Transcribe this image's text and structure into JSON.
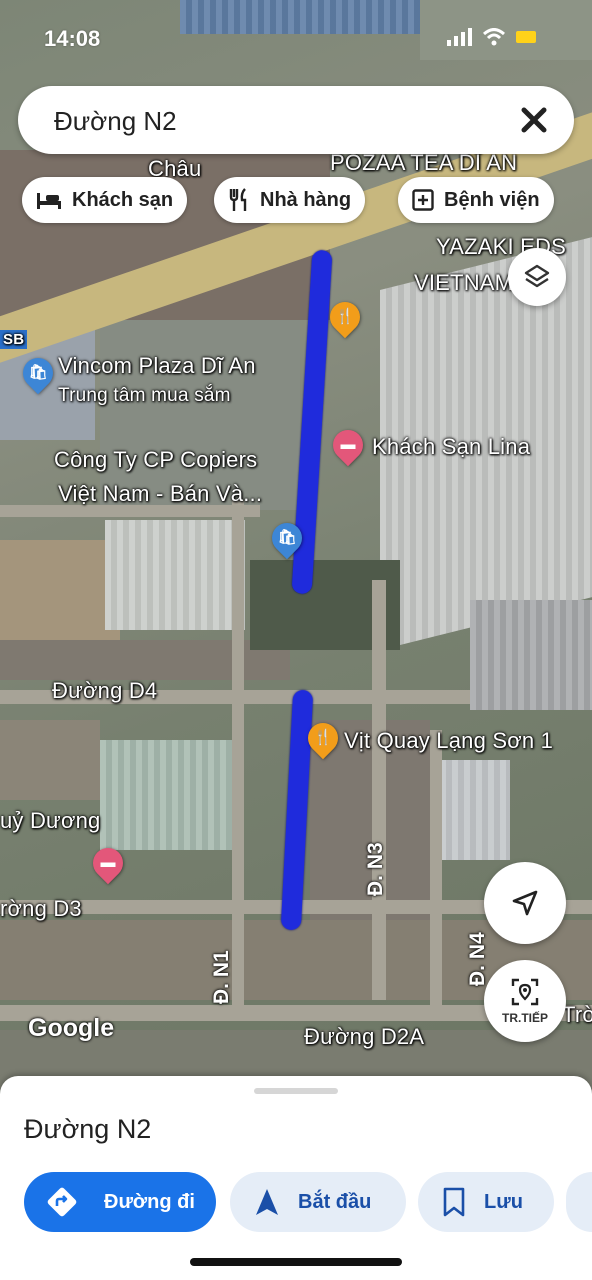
{
  "status_bar": {
    "time": "14:08"
  },
  "search": {
    "query": "Đường N2"
  },
  "chips": [
    {
      "label": "Khách sạn",
      "icon": "bed-icon"
    },
    {
      "label": "Nhà hàng",
      "icon": "restaurant-icon"
    },
    {
      "label": "Bệnh viện",
      "icon": "hospital-icon"
    }
  ],
  "map_labels": {
    "pozaa": "POZAA TEA DĨ AN",
    "chau": "Châu",
    "yazaki_1": "YAZAKI EDS",
    "yazaki_2": "VIETNAM CO.",
    "vincom_name": "Vincom Plaza Dĩ An",
    "vincom_type": "Trung tâm mua sắm",
    "copiers_1": "Công Ty CP Copiers",
    "copiers_2": "Việt Nam - Bán Và...",
    "lina": "Khách Sạn Lina",
    "d4": "Đường D4",
    "vit_quay": "Vịt Quay Lạng Sơn 1",
    "thuy_duong": "uỷ Dương",
    "d3": "rờng D3",
    "n1": "Đ. N1",
    "n3": "Đ. N3",
    "n4": "Đ. N4",
    "d2a": "Đường D2A",
    "tro": "Trờ",
    "sb": "SB"
  },
  "map_controls": {
    "layers_icon": "layers-icon",
    "compass_icon": "navigation-arrow-icon",
    "live_view_label": "TR.TIẾP"
  },
  "attribution": "Google",
  "sheet": {
    "title": "Đường N2",
    "actions": [
      {
        "label": "Đường đi",
        "icon": "directions-icon"
      },
      {
        "label": "Bắt đầu",
        "icon": "navigate-arrow-icon"
      },
      {
        "label": "Lưu",
        "icon": "bookmark-icon"
      }
    ]
  },
  "colors": {
    "route": "#1f2bdc",
    "primary_button": "#1a73e8",
    "pin_orange": "#f29d1a",
    "pin_pink": "#e3577a",
    "pin_blue": "#3d86d6"
  }
}
